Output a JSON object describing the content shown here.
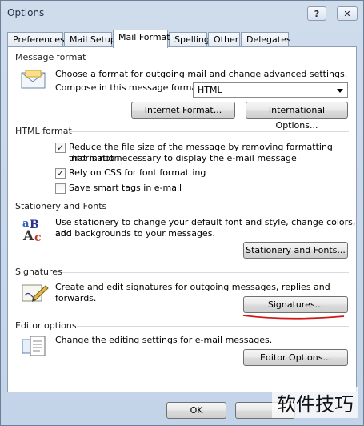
{
  "window": {
    "title": "Options",
    "help_label": "?",
    "close_label": "✕"
  },
  "tabs": [
    {
      "label": "Preferences"
    },
    {
      "label": "Mail Setup"
    },
    {
      "label": "Mail Format"
    },
    {
      "label": "Spelling"
    },
    {
      "label": "Other"
    },
    {
      "label": "Delegates"
    }
  ],
  "active_tab": "Mail Format",
  "message_format": {
    "title": "Message format",
    "desc": "Choose a format for outgoing mail and change advanced settings.",
    "compose_label": "Compose in this message format:",
    "format_value": "HTML",
    "internet_format_btn": "Internet Format...",
    "international_options_btn": "International Options..."
  },
  "html_format": {
    "title": "HTML format",
    "options": [
      {
        "label": "Reduce the file size of the message by removing formatting information",
        "label2": "that is not necessary to display the e-mail message",
        "checked": true
      },
      {
        "label": "Rely on CSS for font formatting",
        "checked": true
      },
      {
        "label": "Save smart tags in e-mail",
        "checked": false
      }
    ]
  },
  "stationery": {
    "title": "Stationery and Fonts",
    "desc1": "Use stationery to change your default font and style, change colors, and",
    "desc2": "add backgrounds to your messages.",
    "button": "Stationery and Fonts..."
  },
  "signatures": {
    "title": "Signatures",
    "desc": "Create and edit signatures for outgoing messages, replies and forwards.",
    "button": "Signatures..."
  },
  "editor": {
    "title": "Editor options",
    "desc": "Change the editing settings for e-mail messages.",
    "button": "Editor Options..."
  },
  "footer": {
    "ok_label": "OK"
  },
  "watermark": "软件技巧",
  "colors": {
    "annotation": "#d01818",
    "check": "#1b1b1b"
  }
}
